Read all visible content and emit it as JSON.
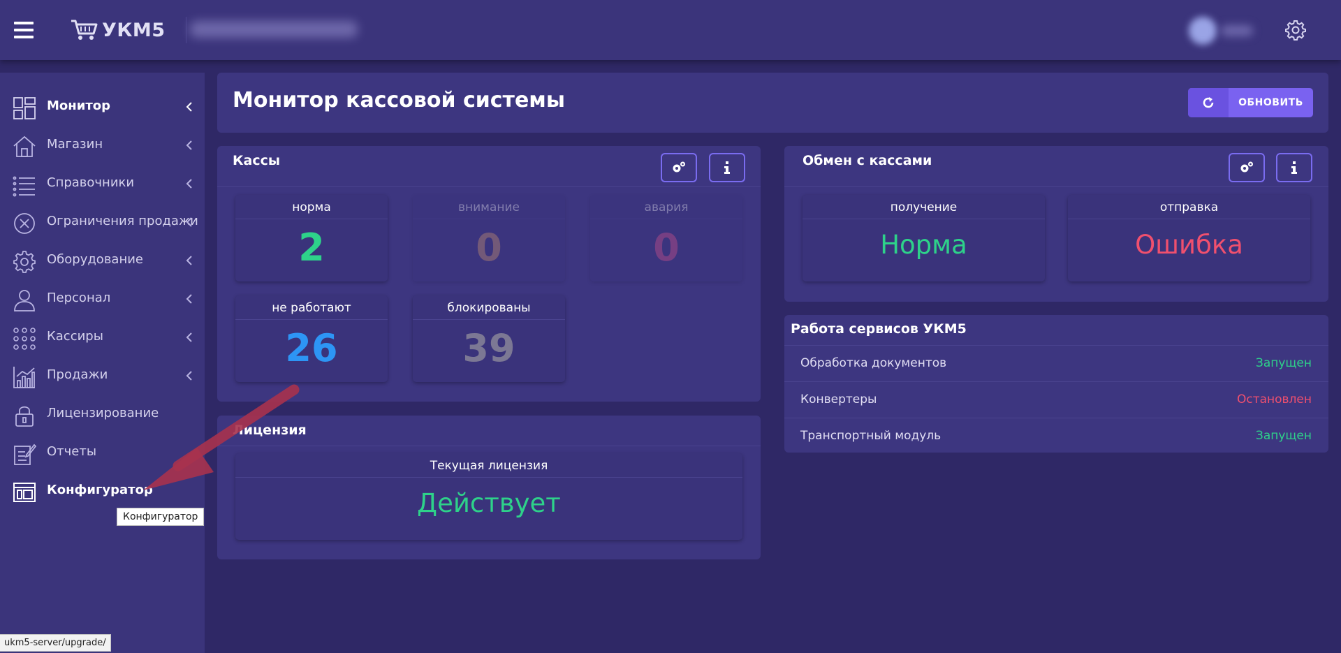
{
  "app": {
    "logo_text": "УКМ5"
  },
  "sidebar": {
    "items": [
      {
        "label": "Монитор",
        "icon": "dashboard-grid-icon"
      },
      {
        "label": "Магазин",
        "icon": "home-icon"
      },
      {
        "label": "Справочники",
        "icon": "list-icon"
      },
      {
        "label": "Ограничения продажи",
        "icon": "close-circle-icon"
      },
      {
        "label": "Оборудование",
        "icon": "gear-icon"
      },
      {
        "label": "Персонал",
        "icon": "user-icon"
      },
      {
        "label": "Кассиры",
        "icon": "dots-grid-icon"
      },
      {
        "label": "Продажи",
        "icon": "chart-icon"
      },
      {
        "label": "Лицензирование",
        "icon": "lock-icon"
      },
      {
        "label": "Отчеты",
        "icon": "report-edit-icon"
      },
      {
        "label": "Конфигуратор",
        "icon": "window-layout-icon"
      }
    ],
    "tooltip": "Конфигуратор"
  },
  "header": {
    "title": "Монитор кассовой системы",
    "refresh_label": "ОБНОВИТЬ"
  },
  "kassy": {
    "title": "Кассы",
    "tiles": [
      {
        "label": "норма",
        "value": "2"
      },
      {
        "label": "внимание",
        "value": "0"
      },
      {
        "label": "авария",
        "value": "0"
      },
      {
        "label": "не работают",
        "value": "26"
      },
      {
        "label": "блокированы",
        "value": "39"
      }
    ]
  },
  "license": {
    "title": "Лицензия",
    "label": "Текущая лицензия",
    "status": "Действует"
  },
  "exchange": {
    "title": "Обмен с кассами",
    "tiles": [
      {
        "label": "получение",
        "status": "Норма"
      },
      {
        "label": "отправка",
        "status": "Ошибка"
      }
    ]
  },
  "services": {
    "title": "Работа сервисов УКМ5",
    "rows": [
      {
        "name": "Обработка документов",
        "status": "Запущен"
      },
      {
        "name": "Конвертеры",
        "status": "Остановлен"
      },
      {
        "name": "Транспортный модуль",
        "status": "Запущен"
      }
    ]
  },
  "statusbar": {
    "url": "ukm5-server/upgrade/"
  },
  "colors": {
    "green": "#2ed28a",
    "blue": "#2d95f5",
    "gray": "#7c7894",
    "red": "#f0506e",
    "accent": "#7a62f0",
    "arrow": "#a8324e"
  }
}
